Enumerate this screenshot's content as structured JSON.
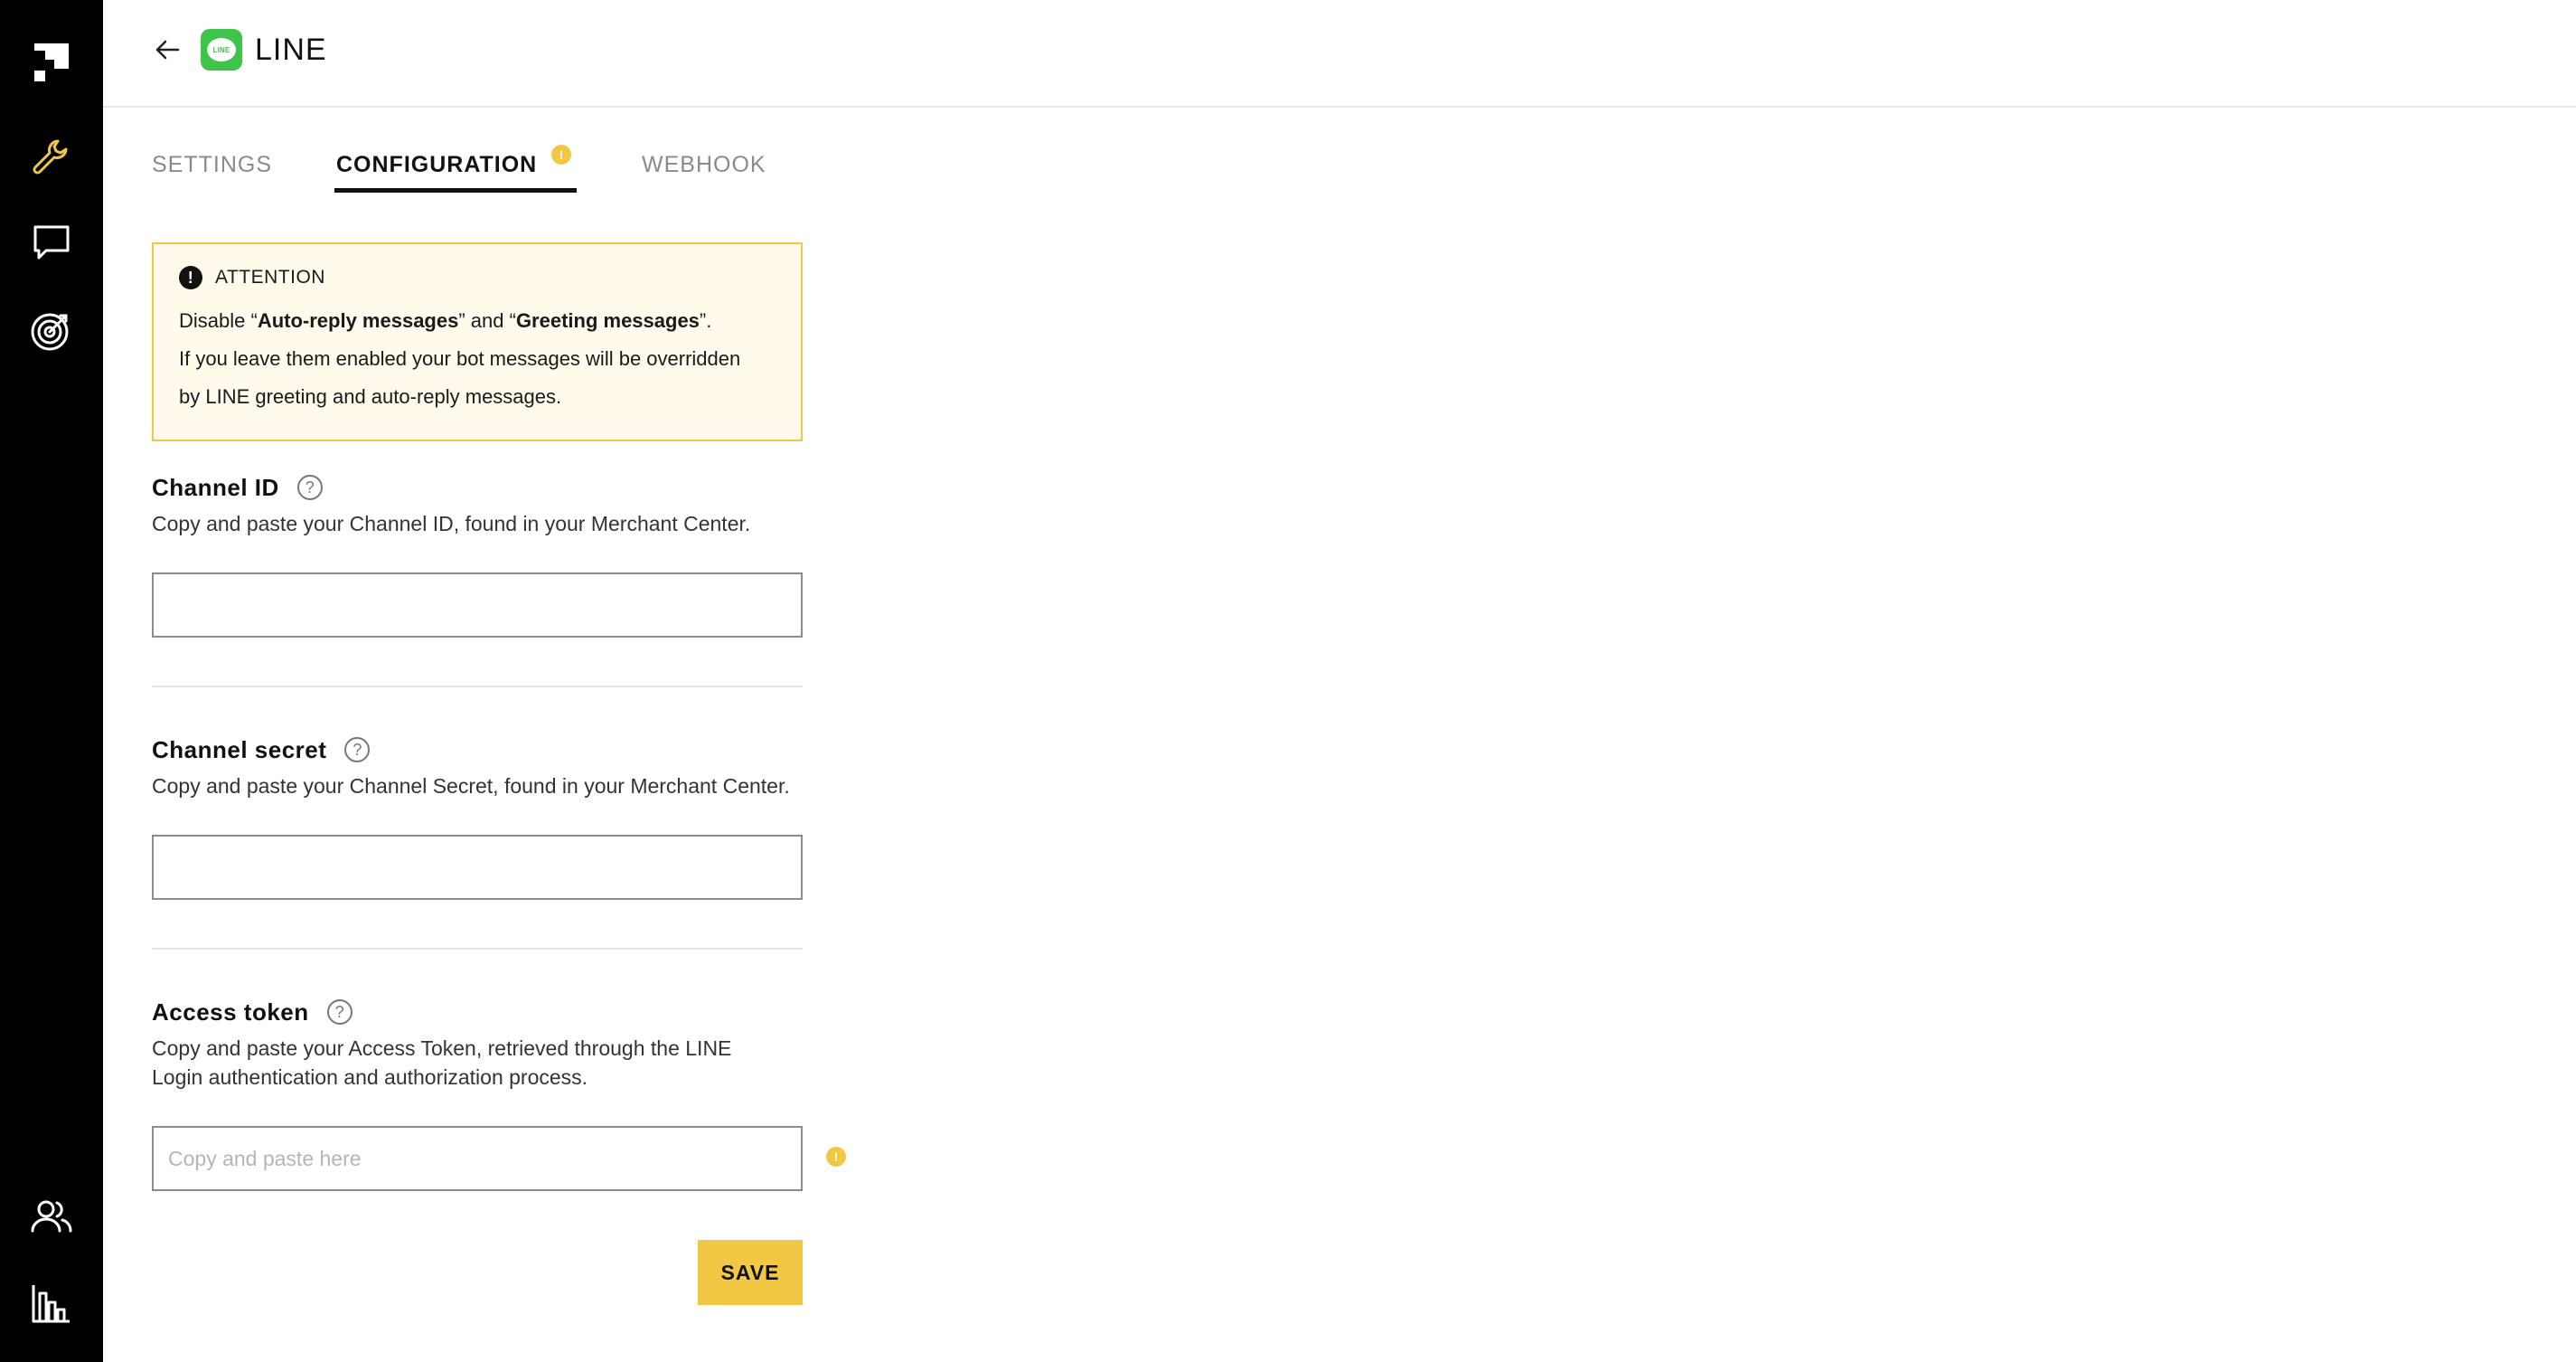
{
  "colors": {
    "sidebar_bg": "#000000",
    "accent": "#f2c744",
    "line_green": "#3ec34b",
    "attention_bg": "#fffaeb",
    "attention_border": "#f2c744"
  },
  "sidebar": {
    "items": [
      {
        "name": "app-logo-icon"
      },
      {
        "name": "wrench-icon"
      },
      {
        "name": "chat-bubble-icon"
      },
      {
        "name": "target-icon"
      },
      {
        "name": "users-icon"
      },
      {
        "name": "bar-chart-icon"
      }
    ]
  },
  "header": {
    "back_icon": "arrow-left-icon",
    "logo_text": "LINE",
    "title": "LINE"
  },
  "tabs": [
    {
      "label": "SETTINGS",
      "active": false
    },
    {
      "label": "CONFIGURATION",
      "active": true,
      "badge": "!"
    },
    {
      "label": "WEBHOOK",
      "active": false
    }
  ],
  "attention": {
    "heading": "ATTENTION",
    "icon": "!",
    "line1_pre": "Disable “",
    "line1_b1": "Auto-reply messages",
    "line1_mid": "” and “",
    "line1_b2": "Greeting messages",
    "line1_post": "”.",
    "line2": "If you leave them enabled your bot messages will be overridden",
    "line3": "by LINE greeting and auto-reply messages."
  },
  "fields": {
    "channel_id": {
      "label": "Channel ID",
      "help": "?",
      "description": "Copy and paste your Channel ID, found in your Merchant Center.",
      "value": "",
      "placeholder": ""
    },
    "channel_secret": {
      "label": "Channel secret",
      "help": "?",
      "description": "Copy and paste your Channel Secret, found in your Merchant Center.",
      "value": "",
      "placeholder": ""
    },
    "access_token": {
      "label": "Access token",
      "help": "?",
      "description_line1": "Copy and paste your Access Token, retrieved through the LINE",
      "description_line2": "Login authentication and authorization process.",
      "value": "",
      "placeholder": "Copy and paste here",
      "warning": "!"
    }
  },
  "actions": {
    "save_label": "SAVE"
  }
}
